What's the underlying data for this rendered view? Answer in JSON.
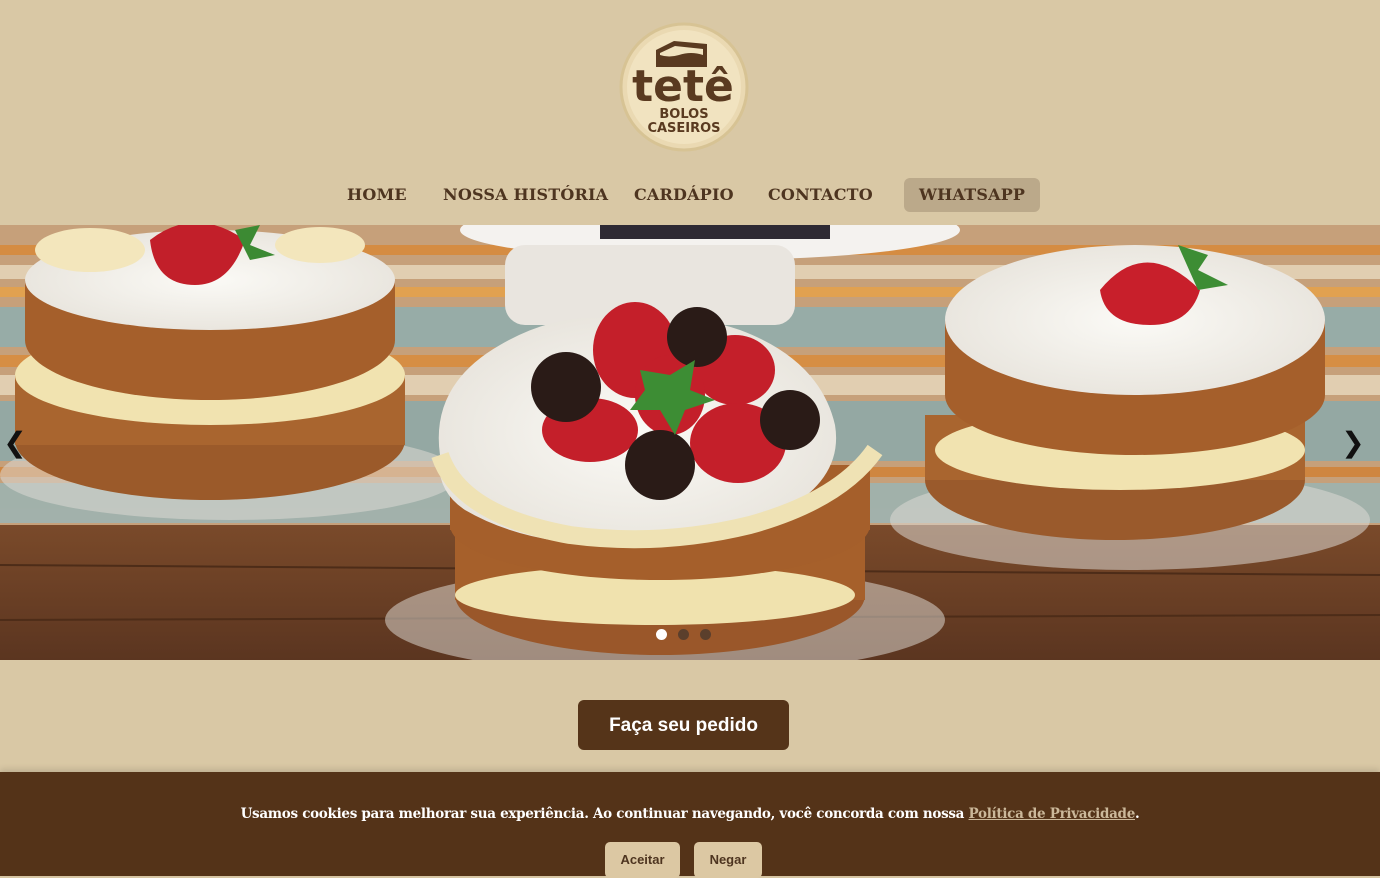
{
  "brand": {
    "logo_main": "tetê",
    "logo_line1": "BOLOS",
    "logo_line2": "CASEIROS",
    "colors": {
      "background": "#d9c8a5",
      "primary": "#553419",
      "accent": "#bba98a"
    }
  },
  "nav": {
    "home": "HOME",
    "history": "NOSSA HISTÓRIA",
    "menu": "CARDÁPIO",
    "contact": "CONTACTO",
    "whatsapp": "WHATSAPP"
  },
  "carousel": {
    "prev_icon": "❮",
    "next_icon": "❯",
    "slide_count": 3,
    "active_slide": 1,
    "image": "cakes-with-strawberries-photo"
  },
  "cta": {
    "order_label": "Faça seu pedido"
  },
  "cookie_banner": {
    "message": "Usamos cookies para melhorar sua experiência. Ao continuar navegando, você concorda com nossa",
    "policy_link": "Política de Privacidade",
    "period": ".",
    "accept_label": "Aceitar",
    "deny_label": "Negar"
  }
}
